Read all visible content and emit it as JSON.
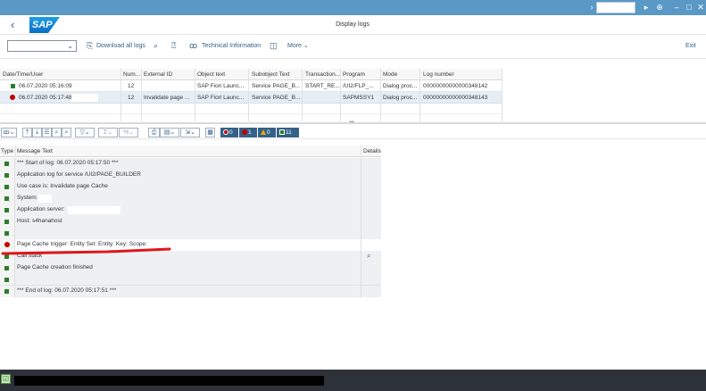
{
  "app": {
    "title": "Display logs",
    "logo_text": "SAP"
  },
  "system_bar": {
    "icons": [
      "chevron-right-icon",
      "play-icon",
      "lock-icon",
      "minimize-icon",
      "maximize-icon",
      "close-icon"
    ]
  },
  "toolbar": {
    "variant_value": "",
    "download_label": "Download all logs",
    "techinfo_label": "Technical Information",
    "more_label": "More",
    "exit_label": "Exit"
  },
  "log_table": {
    "columns": [
      "Date/Time/User",
      "Num...",
      "External ID",
      "Object text",
      "Subobject Text",
      "Transaction...",
      "Program",
      "Mode",
      "Log number"
    ],
    "rows": [
      {
        "status": "green",
        "datetime": "06.07.2020  05:16:09",
        "num": "12",
        "external_id": "",
        "object_text": "SAP Fiori Launc...",
        "subobject_text": "Service PAGE_B...",
        "transaction": "START_RE...",
        "program": "/UI2/FLP_...",
        "mode": "Dialog proc...",
        "log_number": "00000000000000348142"
      },
      {
        "status": "red",
        "datetime": "06.07.2020  05:17:48",
        "num": "12",
        "external_id": "Invalidate page ...",
        "object_text": "SAP Fiori Launc...",
        "subobject_text": "Service PAGE_B...",
        "transaction": "",
        "program": "SAPMSSY1",
        "mode": "Dialog proc...",
        "log_number": "00000000000000348143"
      }
    ]
  },
  "filter_counts": {
    "errors_stop": "0",
    "errors": "1",
    "warnings": "0",
    "info": "11"
  },
  "message_table": {
    "columns": [
      "Type",
      "Message Text",
      "Details"
    ],
    "rows": [
      {
        "type": "green",
        "text": "*** Start of log: 06.07.2020 05:17:50 ***"
      },
      {
        "type": "green",
        "text": "Application log for service /UI2/PAGE_BUILDER"
      },
      {
        "type": "green",
        "text": "Use case is: Invalidate page Cache"
      },
      {
        "type": "green",
        "text": "System:"
      },
      {
        "type": "green",
        "text": "Application server:"
      },
      {
        "type": "green",
        "text": "Host: s4hanahost"
      },
      {
        "type": "green",
        "text": ""
      },
      {
        "type": "red",
        "text": "Page Cache trigger: Entity Set:  Entity:  Key:  Scope:"
      },
      {
        "type": "green",
        "text": "Call stack"
      },
      {
        "type": "green",
        "text": "Page Cache creation finished"
      },
      {
        "type": "green",
        "text": ""
      },
      {
        "type": "green",
        "text": ""
      },
      {
        "type": "green",
        "text": "*** End of log: 06.07.2020 05:17:51 ***"
      }
    ]
  },
  "colors": {
    "shell_blue": "#5a99c6",
    "accent": "#346187",
    "success": "#2b7d2b",
    "error": "#c00000",
    "warning": "#f0ab00",
    "annotation_red": "#e0161b"
  }
}
